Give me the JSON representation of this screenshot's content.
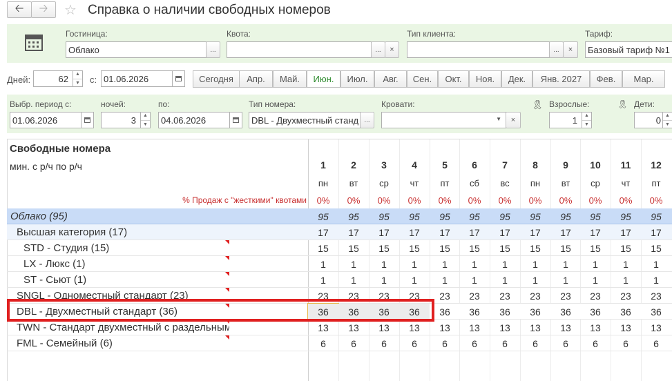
{
  "title": "Справка о наличии свободных номеров",
  "filters": {
    "hotel_label": "Гостиница:",
    "hotel_value": "Облако",
    "quota_label": "Квота:",
    "quota_value": "",
    "client_type_label": "Тип клиента:",
    "client_type_value": "",
    "tariff_label": "Тариф:",
    "tariff_value": "Базовый тариф №1"
  },
  "period": {
    "days_label": "Дней:",
    "days_value": "62",
    "from_label": "с:",
    "from_value": "01.06.2026",
    "today_btn": "Сегодня",
    "months": [
      "Апр.",
      "Май.",
      "Июн.",
      "Июл.",
      "Авг.",
      "Сен.",
      "Окт.",
      "Ноя.",
      "Дек.",
      "Янв. 2027",
      "Фев.",
      "Мар."
    ],
    "active_month": "Июн."
  },
  "selection": {
    "period_from_label": "Выбр. период с:",
    "period_from_value": "01.06.2026",
    "nights_label": "ночей:",
    "nights_value": "3",
    "to_label": "по:",
    "to_value": "04.06.2026",
    "room_type_label": "Тип номера:",
    "room_type_value": "DBL - Двухместный станд",
    "beds_label": "Кровати:",
    "beds_value": "",
    "adults_label": "Взрослые:",
    "adults_value": "1",
    "children_label": "Дети:",
    "children_value": "0"
  },
  "grid": {
    "title": "Свободные номера",
    "subtitle": "мин. с р/ч по р/ч",
    "sales_label": "% Продаж с \"жесткими\" квотами",
    "days": [
      "1",
      "2",
      "3",
      "4",
      "5",
      "6",
      "7",
      "8",
      "9",
      "10",
      "11",
      "12"
    ],
    "weekdays": [
      "пн",
      "вт",
      "ср",
      "чт",
      "пт",
      "сб",
      "вс",
      "пн",
      "вт",
      "ср",
      "чт",
      "пт"
    ],
    "percents": [
      "0%",
      "0%",
      "0%",
      "0%",
      "0%",
      "0%",
      "0%",
      "0%",
      "0%",
      "0%",
      "0%",
      "0%"
    ],
    "rows": [
      {
        "name": "Облако (95)",
        "level": 0,
        "values": [
          "95",
          "95",
          "95",
          "95",
          "95",
          "95",
          "95",
          "95",
          "95",
          "95",
          "95",
          "95"
        ]
      },
      {
        "name": "Высшая категория (17)",
        "level": 1,
        "values": [
          "17",
          "17",
          "17",
          "17",
          "17",
          "17",
          "17",
          "17",
          "17",
          "17",
          "17",
          "17"
        ]
      },
      {
        "name": "STD - Студия (15)",
        "level": 2,
        "values": [
          "15",
          "15",
          "15",
          "15",
          "15",
          "15",
          "15",
          "15",
          "15",
          "15",
          "15",
          "15"
        ]
      },
      {
        "name": "LX - Люкс (1)",
        "level": 2,
        "values": [
          "1",
          "1",
          "1",
          "1",
          "1",
          "1",
          "1",
          "1",
          "1",
          "1",
          "1",
          "1"
        ]
      },
      {
        "name": "ST - Сьют (1)",
        "level": 2,
        "values": [
          "1",
          "1",
          "1",
          "1",
          "1",
          "1",
          "1",
          "1",
          "1",
          "1",
          "1",
          "1"
        ]
      },
      {
        "name": "SNGL - Одноместный стандарт (23)",
        "level": 1,
        "values": [
          "23",
          "23",
          "23",
          "23",
          "23",
          "23",
          "23",
          "23",
          "23",
          "23",
          "23",
          "23"
        ]
      },
      {
        "name": "DBL - Двухместный стандарт (36)",
        "level": 1,
        "values": [
          "36",
          "36",
          "36",
          "36",
          "36",
          "36",
          "36",
          "36",
          "36",
          "36",
          "36",
          "36"
        ]
      },
      {
        "name": "TWN - Стандарт двухместный с раздельными кроватями",
        "level": 1,
        "values": [
          "13",
          "13",
          "13",
          "13",
          "13",
          "13",
          "13",
          "13",
          "13",
          "13",
          "13",
          "13"
        ]
      },
      {
        "name": "FML - Семейный (6)",
        "level": 1,
        "values": [
          "6",
          "6",
          "6",
          "6",
          "6",
          "6",
          "6",
          "6",
          "6",
          "6",
          "6",
          "6"
        ]
      }
    ]
  },
  "colors": {
    "accent_green": "#2e8b2e",
    "group_row": "#c9dcf7",
    "subgroup_row": "#eef4fc",
    "highlight_border": "#e02020",
    "red_marker": "#e02020"
  }
}
